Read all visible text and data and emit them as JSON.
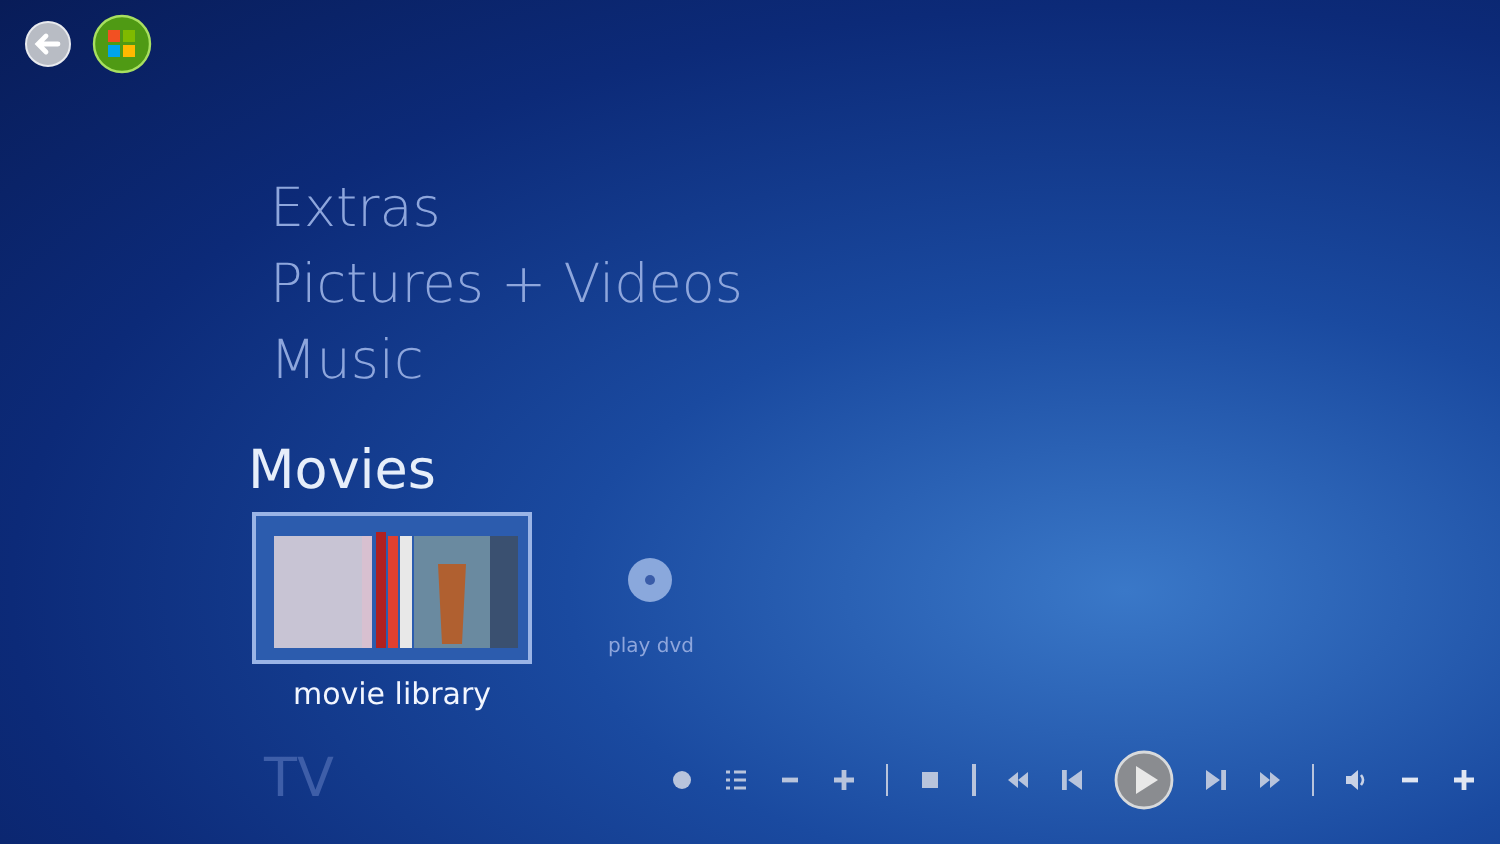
{
  "categories": [
    {
      "label": "Extras",
      "selected": false
    },
    {
      "label": "Pictures + Videos",
      "selected": false
    },
    {
      "label": "Music",
      "selected": false
    },
    {
      "label": "Movies",
      "selected": true
    }
  ],
  "items": [
    {
      "kind": "library",
      "label": "movie library",
      "selected": true
    },
    {
      "kind": "disc",
      "label": "play dvd",
      "selected": false
    }
  ],
  "next_category": {
    "label": "TV"
  }
}
